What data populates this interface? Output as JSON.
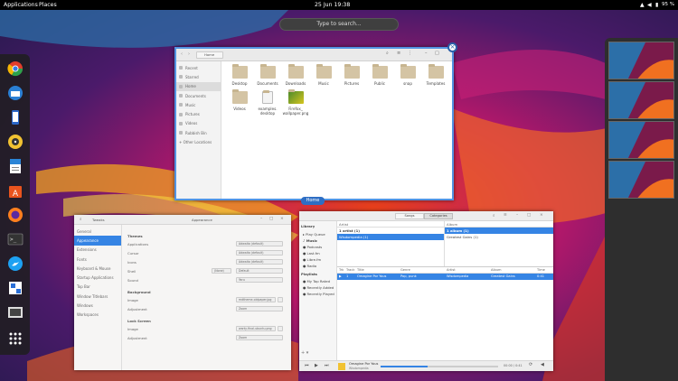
{
  "topbar": {
    "applications": "Applications",
    "places": "Places",
    "datetime": "25 Jun  19:38",
    "battery": "95 %"
  },
  "search": {
    "placeholder": "Type to search..."
  },
  "dock": [
    {
      "name": "chrome-icon"
    },
    {
      "name": "thunderbird-icon"
    },
    {
      "name": "phone-icon"
    },
    {
      "name": "rhythmbox-icon"
    },
    {
      "name": "writer-icon"
    },
    {
      "name": "software-icon"
    },
    {
      "name": "firefox-icon"
    },
    {
      "name": "terminal-icon"
    },
    {
      "name": "twitter-icon"
    },
    {
      "name": "settings-icon"
    },
    {
      "name": "screenshot-icon"
    },
    {
      "name": "app-grid-icon"
    }
  ],
  "files": {
    "path": "Home",
    "caption": "Home",
    "sidebar": [
      "Recent",
      "Starred",
      "Home",
      "Documents",
      "Music",
      "Pictures",
      "Videos",
      "Rubbish Bin",
      "+ Other Locations"
    ],
    "folders": [
      {
        "label": "Desktop"
      },
      {
        "label": "Documents"
      },
      {
        "label": "Downloads"
      },
      {
        "label": "Music"
      },
      {
        "label": "Pictures"
      },
      {
        "label": "Public"
      },
      {
        "label": "snap"
      },
      {
        "label": "Templates"
      },
      {
        "label": "Videos"
      },
      {
        "label": "examples.\ndesktop"
      },
      {
        "label": "Firefox_\nwallpaper.png"
      }
    ]
  },
  "tweaks": {
    "app_title": "Tweaks",
    "panel_title": "Appearance",
    "sidebar": [
      "General",
      "Appearance",
      "Extensions",
      "Fonts",
      "Keyboard & Mouse",
      "Startup Applications",
      "Top Bar",
      "Window Titlebars",
      "Windows",
      "Workspaces"
    ],
    "themes_heading": "Themes",
    "themes": [
      {
        "label": "Applications",
        "value": "Adwaita (default)"
      },
      {
        "label": "Cursor",
        "value": "Adwaita (default)"
      },
      {
        "label": "Icons",
        "value": "Adwaita (default)"
      },
      {
        "label": "Shell",
        "value": "Default"
      },
      {
        "label": "Sound",
        "value": "Yaru"
      }
    ],
    "shell_none": "(None)",
    "background_heading": "Background",
    "background": [
      {
        "label": "Image",
        "value": "mdtheme-oldpaper.jpg"
      },
      {
        "label": "Adjustment",
        "value": "Zoom"
      }
    ],
    "lock_heading": "Lock Screen",
    "lock": [
      {
        "label": "Image",
        "value": "warty-final-ubuntu.png"
      },
      {
        "label": "Adjustment",
        "value": "Zoom"
      }
    ]
  },
  "rhythmbox": {
    "tabs": [
      "Songs",
      "Categories"
    ],
    "library_heading": "Library",
    "library": [
      "Play Queue",
      "Music",
      "Podcasts",
      "Last.fm",
      "Libre.fm",
      "Radio"
    ],
    "playlists_heading": "Playlists",
    "playlists": [
      "My Top Rated",
      "Recently Added",
      "Recently Played"
    ],
    "artist_header": "Artist",
    "artists": [
      "1 artist (1)",
      "Wisdompedia (1)"
    ],
    "album_header": "Album",
    "albums": [
      "1 album (1)",
      "Greatest Gains (1)"
    ],
    "columns": [
      "Trk",
      "Track",
      "Title",
      "Genre",
      "Artist",
      "Album",
      "Time"
    ],
    "track": {
      "num": "1",
      "title": "Omagine Por Yous",
      "genre": "Pop, punk",
      "artist": "Wisdompedia",
      "album": "Greatest Gains",
      "time": "0:41"
    },
    "now_title": "Omagine Por Yous",
    "now_artist": "Wisdompedia",
    "time_readout": "00:00 / 0:41"
  }
}
